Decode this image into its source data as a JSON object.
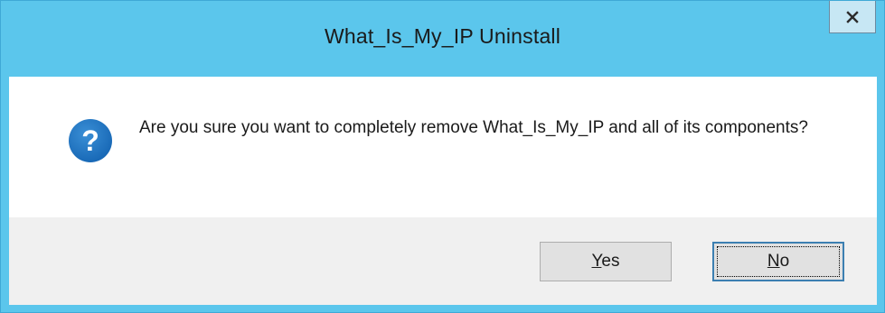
{
  "dialog": {
    "title": "What_Is_My_IP Uninstall",
    "close_label": "x",
    "message": "Are you sure you want to completely remove What_Is_My_IP and all of its components?",
    "icon": "question-icon",
    "icon_glyph": "?"
  },
  "buttons": {
    "yes": {
      "mnemonic": "Y",
      "rest": "es"
    },
    "no": {
      "mnemonic": "N",
      "rest": "o"
    }
  },
  "colors": {
    "titlebar": "#5bc6ec",
    "icon": "#1e73be",
    "button_face": "#e1e1e1",
    "focus_border": "#3c7fb1"
  }
}
